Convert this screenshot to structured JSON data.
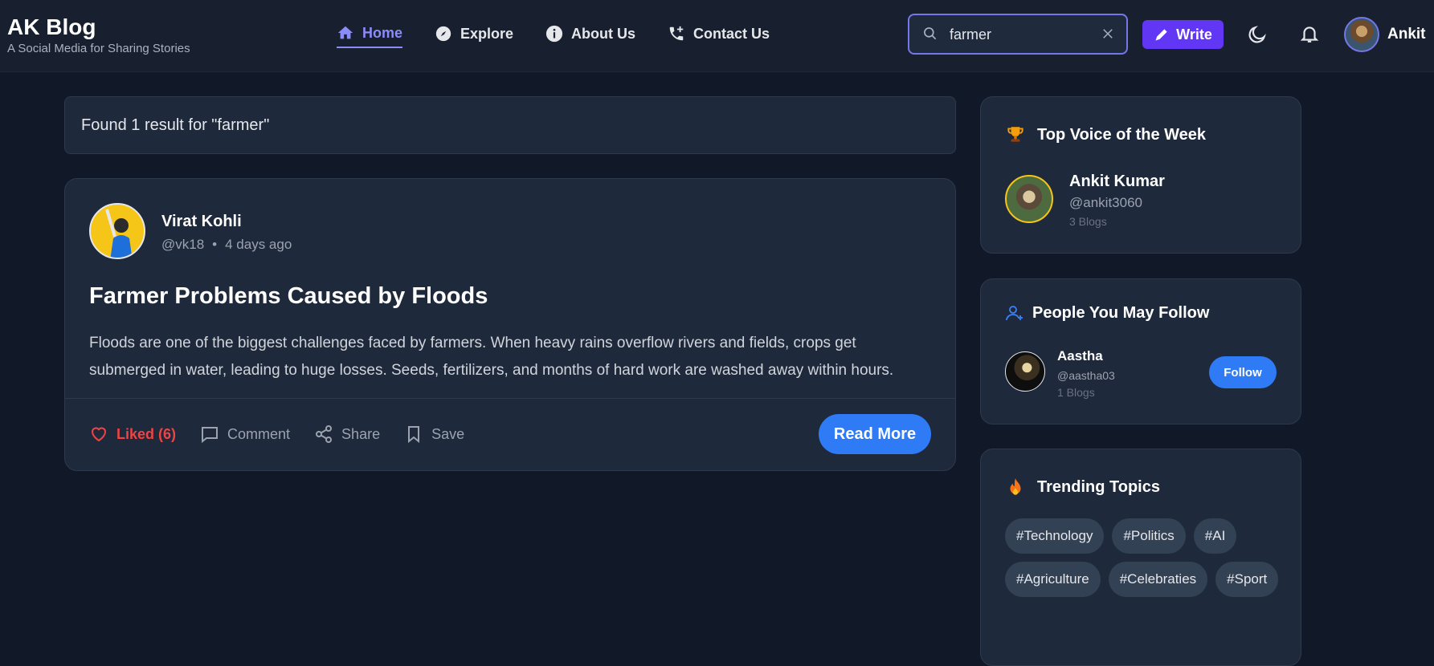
{
  "brand": {
    "title": "AK Blog",
    "subtitle": "A Social Media for Sharing Stories"
  },
  "nav": {
    "home": "Home",
    "explore": "Explore",
    "about": "About Us",
    "contact": "Contact Us"
  },
  "search": {
    "value": "farmer"
  },
  "header": {
    "write_label": "Write",
    "user_name": "Ankit"
  },
  "results": {
    "text": "Found 1 result for \"farmer\""
  },
  "post": {
    "author": "Virat Kohli",
    "handle": "@vk18",
    "separator": "•",
    "time": "4 days ago",
    "title": "Farmer Problems Caused by Floods",
    "body": "Floods are one of the biggest challenges faced by farmers. When heavy rains overflow rivers and fields, crops get submerged in water, leading to huge losses. Seeds, fertilizers, and months of hard work are washed away within hours.",
    "liked_label": "Liked (6)",
    "comment_label": "Comment",
    "share_label": "Share",
    "save_label": "Save",
    "read_more": "Read More"
  },
  "top_voice": {
    "heading": "Top Voice of the Week",
    "name": "Ankit Kumar",
    "handle": "@ankit3060",
    "blogs": "3 Blogs"
  },
  "follow": {
    "heading": "People You May Follow",
    "name": "Aastha",
    "handle": "@aastha03",
    "blogs": "1 Blogs",
    "button": "Follow"
  },
  "trending": {
    "heading": "Trending Topics",
    "tags": [
      "#Technology",
      "#Politics",
      "#AI",
      "#Agriculture",
      "#Celebraties",
      "#Sport"
    ]
  },
  "colors": {
    "accent": "#8b8cf8",
    "primary_button": "#2f7bf6",
    "write_button": "#6236f5",
    "liked": "#ef4444"
  }
}
